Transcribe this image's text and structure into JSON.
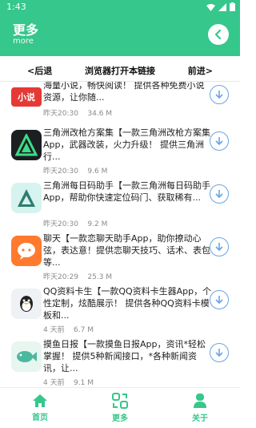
{
  "status": {
    "time": "1:43"
  },
  "header": {
    "title": "更多",
    "subtitle": "more"
  },
  "browser_bar": {
    "back": "<后退",
    "open": "浏览器打开本链接",
    "forward": "前进>"
  },
  "items": [
    {
      "desc": "海量小说，畅快阅读！ 提供各种免费小说资源，让你随...",
      "time": "昨天20:30",
      "size": "34.6 M",
      "icon": "novel-app-icon"
    },
    {
      "desc": "三角洲改枪方案集【一款三角洲改枪方案集App，武器改装，火力升级！ 提供三角洲行...",
      "time": "昨天20:30",
      "size": "9.6 M",
      "icon": "delta-gun-app-icon"
    },
    {
      "desc": "三角洲每日码助手【一款三角洲每日码助手App，帮助你快速定位码门、获取稀有...",
      "time": "昨天20:30",
      "size": "9.2 M",
      "icon": "delta-code-app-icon"
    },
    {
      "desc": "聊天【一款恋聊天助手App，助你撩动心弦，表达意！提供恋聊天技巧、话术、表包等...",
      "time": "昨天20:29",
      "size": "25.3 M",
      "icon": "chat-app-icon"
    },
    {
      "desc": "QQ资料卡生【一款QQ资料卡生器App，个性定制，炫酷展示！ 提供各种QQ资料卡模板和...",
      "time": "4 天前",
      "size": "6.7 M",
      "icon": "qq-card-app-icon"
    },
    {
      "desc": "摸鱼日报【一款摸鱼日报App，资讯*轻松掌握！ 提供5种新闻接口，*各种新闻资讯，让...",
      "time": "4 天前",
      "size": "9.1 M",
      "icon": "fish-daily-app-icon"
    }
  ],
  "nav": [
    {
      "label": "首页",
      "icon": "home-icon"
    },
    {
      "label": "更多",
      "icon": "more-icon"
    },
    {
      "label": "关于",
      "icon": "person-icon"
    }
  ],
  "colors": {
    "accent": "#35c78b",
    "download_ring": "#6aa3e6"
  }
}
